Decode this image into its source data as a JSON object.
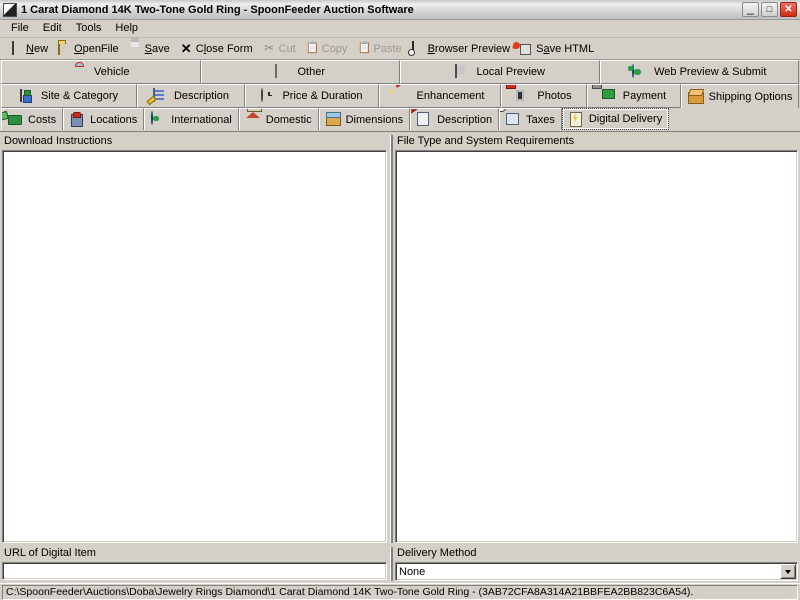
{
  "window": {
    "title": "1 Carat Diamond 14K Two-Tone Gold Ring - SpoonFeeder Auction Software",
    "app_icon": "app-icon",
    "minimize_label": "_",
    "maximize_label": "□",
    "close_label": "✕"
  },
  "menu": {
    "items": [
      {
        "label": "File"
      },
      {
        "label": "Edit"
      },
      {
        "label": "Tools"
      },
      {
        "label": "Help"
      }
    ]
  },
  "toolbar": {
    "buttons": [
      {
        "label": "New",
        "accel": "N",
        "icon": "new-page-icon",
        "enabled": true
      },
      {
        "label": "OpenFile",
        "accel": "O",
        "icon": "open-folder-icon",
        "enabled": true
      },
      {
        "label": "Save",
        "accel": "S",
        "icon": "save-disk-icon",
        "enabled": true
      },
      {
        "label": "Close Form",
        "accel": "l",
        "icon": "close-x-icon",
        "enabled": true
      },
      {
        "label": "Cut",
        "accel": "",
        "icon": "scissors-icon",
        "enabled": false
      },
      {
        "label": "Copy",
        "accel": "",
        "icon": "copy-icon",
        "enabled": false
      },
      {
        "label": "Paste",
        "accel": "",
        "icon": "paste-icon",
        "enabled": false
      },
      {
        "label": "Browser Preview",
        "accel": "B",
        "icon": "browser-preview-icon",
        "enabled": true
      },
      {
        "label": "Save HTML",
        "accel": "a",
        "icon": "save-html-icon",
        "enabled": true
      }
    ]
  },
  "tabs_row1": [
    {
      "label": "Vehicle",
      "icon": "car-icon",
      "active": false
    },
    {
      "label": "Other",
      "icon": "barcode-icon",
      "active": false
    },
    {
      "label": "Local Preview",
      "icon": "monitor-icon",
      "active": false
    },
    {
      "label": "Web Preview & Submit",
      "icon": "globe-icon",
      "active": false
    }
  ],
  "tabs_row2": [
    {
      "label": "Site & Category",
      "icon": "site-category-icon",
      "active": false
    },
    {
      "label": "Description",
      "icon": "description-edit-icon",
      "active": false
    },
    {
      "label": "Price & Duration",
      "icon": "clock-icon",
      "active": false
    },
    {
      "label": "Enhancement",
      "icon": "magic-wand-icon",
      "active": false
    },
    {
      "label": "Photos",
      "icon": "photos-film-icon",
      "active": false
    },
    {
      "label": "Payment",
      "icon": "payment-money-icon",
      "active": false
    },
    {
      "label": "Shipping Options",
      "icon": "shipping-box-icon",
      "active": true
    }
  ],
  "tabs_row3": [
    {
      "label": "Costs",
      "icon": "money-costs-icon",
      "active": false
    },
    {
      "label": "Locations",
      "icon": "location-building-icon",
      "active": false
    },
    {
      "label": "International",
      "icon": "globe-international-icon",
      "active": false
    },
    {
      "label": "Domestic",
      "icon": "home-domestic-icon",
      "active": false
    },
    {
      "label": "Dimensions",
      "icon": "dimensions-box-icon",
      "active": false
    },
    {
      "label": "Description",
      "icon": "description-pencil-icon",
      "active": false
    },
    {
      "label": "Taxes",
      "icon": "taxes-icon",
      "active": false
    },
    {
      "label": "Digital Delivery",
      "icon": "digital-delivery-icon",
      "active": true
    }
  ],
  "form": {
    "download_instructions": {
      "label": "Download Instructions",
      "value": ""
    },
    "file_type_requirements": {
      "label": "File Type and System Requirements",
      "value": ""
    },
    "url_of_digital_item": {
      "label": "URL of Digital Item",
      "value": "",
      "placeholder": ""
    },
    "delivery_method": {
      "label": "Delivery Method",
      "value": "None",
      "dropdown_icon": "chevron-down-icon"
    }
  },
  "statusbar": {
    "path": "C:\\SpoonFeeder\\Auctions\\Doba\\Jewelry Rings Diamond\\1 Carat Diamond 14K Two-Tone Gold Ring - (3AB72CFA8A314A21BBFEA2BB823C6A54)."
  },
  "colors": {
    "window_face": "#d4d0c8",
    "field_bg": "#ffffff",
    "close_button": "#cc2b16",
    "text": "#000000"
  }
}
